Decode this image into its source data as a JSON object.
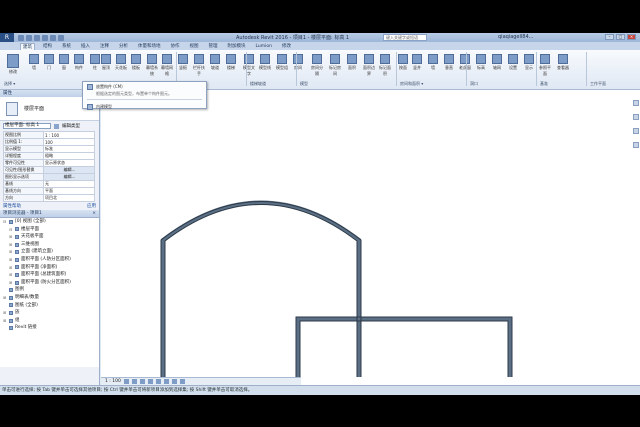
{
  "titlebar": {
    "app_letter": "R",
    "title": "Autodesk Revit 2016 -  项目1 - 楼层平面: 标高 1",
    "search_placeholder": "键入关键字或短语",
    "user": "qiaqiagell84...",
    "minimize": "–",
    "maximize": "□",
    "close": "×"
  },
  "tabs": [
    "建筑",
    "结构",
    "系统",
    "插入",
    "注释",
    "分析",
    "体量和场地",
    "协作",
    "视图",
    "管理",
    "附加模块",
    "Lumion",
    "修改"
  ],
  "ribbon": {
    "buttons": [
      {
        "label": "修改",
        "icon": "modify-icon"
      },
      {
        "label": "墙",
        "icon": "wall-icon"
      },
      {
        "label": "门",
        "icon": "door-icon"
      },
      {
        "label": "窗",
        "icon": "window-icon"
      },
      {
        "label": "构件",
        "icon": "component-icon"
      },
      {
        "label": "柱",
        "icon": "column-icon"
      },
      {
        "label": "屋顶",
        "icon": "roof-icon"
      },
      {
        "label": "天花板",
        "icon": "ceiling-icon"
      },
      {
        "label": "楼板",
        "icon": "floor-icon"
      },
      {
        "label": "幕墙系统",
        "icon": "curtain-system-icon"
      },
      {
        "label": "幕墙网格",
        "icon": "curtain-grid-icon"
      },
      {
        "label": "竖梃",
        "icon": "mullion-icon"
      },
      {
        "label": "栏杆扶手",
        "icon": "railing-icon"
      },
      {
        "label": "坡道",
        "icon": "ramp-icon"
      },
      {
        "label": "楼梯",
        "icon": "stair-icon"
      },
      {
        "label": "模型文字",
        "icon": "model-text-icon"
      },
      {
        "label": "模型线",
        "icon": "model-line-icon"
      },
      {
        "label": "模型组",
        "icon": "model-group-icon"
      },
      {
        "label": "房间",
        "icon": "room-icon"
      },
      {
        "label": "房间分隔",
        "icon": "room-separator-icon"
      },
      {
        "label": "标记房间",
        "icon": "tag-room-icon"
      },
      {
        "label": "面积",
        "icon": "area-icon"
      },
      {
        "label": "面积边界",
        "icon": "area-boundary-icon"
      },
      {
        "label": "标记面积",
        "icon": "tag-area-icon"
      },
      {
        "label": "按面",
        "icon": "by-face-icon"
      },
      {
        "label": "竖井",
        "icon": "shaft-icon"
      },
      {
        "label": "墙",
        "icon": "opening-wall-icon"
      },
      {
        "label": "垂直",
        "icon": "vertical-icon"
      },
      {
        "label": "老虎窗",
        "icon": "dormer-icon"
      },
      {
        "label": "标高",
        "icon": "level-icon"
      },
      {
        "label": "轴网",
        "icon": "grid-icon"
      },
      {
        "label": "设置",
        "icon": "set-icon"
      },
      {
        "label": "显示",
        "icon": "show-icon"
      },
      {
        "label": "参照平面",
        "icon": "ref-plane-icon"
      },
      {
        "label": "查看器",
        "icon": "viewer-icon"
      }
    ],
    "panels": [
      "选择 ▾",
      "构建",
      "楼梯坡道",
      "模型",
      "房间和面积 ▾",
      "洞口",
      "基准",
      "工作平面"
    ]
  },
  "dropdown": {
    "item1_label": "放置构件 (CM)",
    "item1_desc": "根据选定的图元类型，布置单个构件图元。",
    "item2_label": "内建模型",
    "item2_desc_hidden": ""
  },
  "properties": {
    "header": "属性",
    "close": "×",
    "type_name": "楼层平面",
    "selector_value": "楼层平面: 标高 1",
    "edit_type": "编辑类型",
    "rows": [
      {
        "k": "视图比例",
        "v": "1 : 100"
      },
      {
        "k": "比例值 1:",
        "v": "100"
      },
      {
        "k": "显示模型",
        "v": "标准"
      },
      {
        "k": "详细程度",
        "v": "粗略"
      },
      {
        "k": "零件可见性",
        "v": "显示原状态"
      },
      {
        "k": "可见性/图形替换",
        "v": "编辑..."
      },
      {
        "k": "图形显示选项",
        "v": "编辑..."
      },
      {
        "k": "基线",
        "v": "无"
      },
      {
        "k": "基线方向",
        "v": "平面"
      },
      {
        "k": "方向",
        "v": "项目北"
      }
    ],
    "help": "属性帮助",
    "apply": "应用"
  },
  "browser": {
    "header": "项目浏览器 - 项目1",
    "items": [
      {
        "indent": 0,
        "tw": "⊟",
        "label": "[0] 视图 (全部)"
      },
      {
        "indent": 1,
        "tw": "⊟",
        "label": "楼层平面"
      },
      {
        "indent": 1,
        "tw": "⊞",
        "label": "天花板平面"
      },
      {
        "indent": 1,
        "tw": "⊞",
        "label": "三维视图"
      },
      {
        "indent": 1,
        "tw": "⊞",
        "label": "立面 (建筑立面)"
      },
      {
        "indent": 1,
        "tw": "⊞",
        "label": "面积平面 (人防分区面积)"
      },
      {
        "indent": 1,
        "tw": "⊞",
        "label": "面积平面 (净面积)"
      },
      {
        "indent": 1,
        "tw": "⊞",
        "label": "面积平面 (总建筑面积)"
      },
      {
        "indent": 1,
        "tw": "⊞",
        "label": "面积平面 (防火分区面积)"
      },
      {
        "indent": 0,
        "tw": "",
        "label": "图例"
      },
      {
        "indent": 0,
        "tw": "⊞",
        "label": "明细表/数量"
      },
      {
        "indent": 0,
        "tw": "",
        "label": "图纸 (全部)"
      },
      {
        "indent": 0,
        "tw": "⊞",
        "label": "族"
      },
      {
        "indent": 0,
        "tw": "⊞",
        "label": "组"
      },
      {
        "indent": 0,
        "tw": "",
        "label": "Revit 链接"
      }
    ]
  },
  "viewbar": {
    "scale": "1 : 100"
  },
  "status": "单击可进行选择; 按 Tab 键并单击可选择其他项目; 按 Ctrl 键并单击可将新项目添加到选择集; 按 Shift 键并单击可取消选择。"
}
